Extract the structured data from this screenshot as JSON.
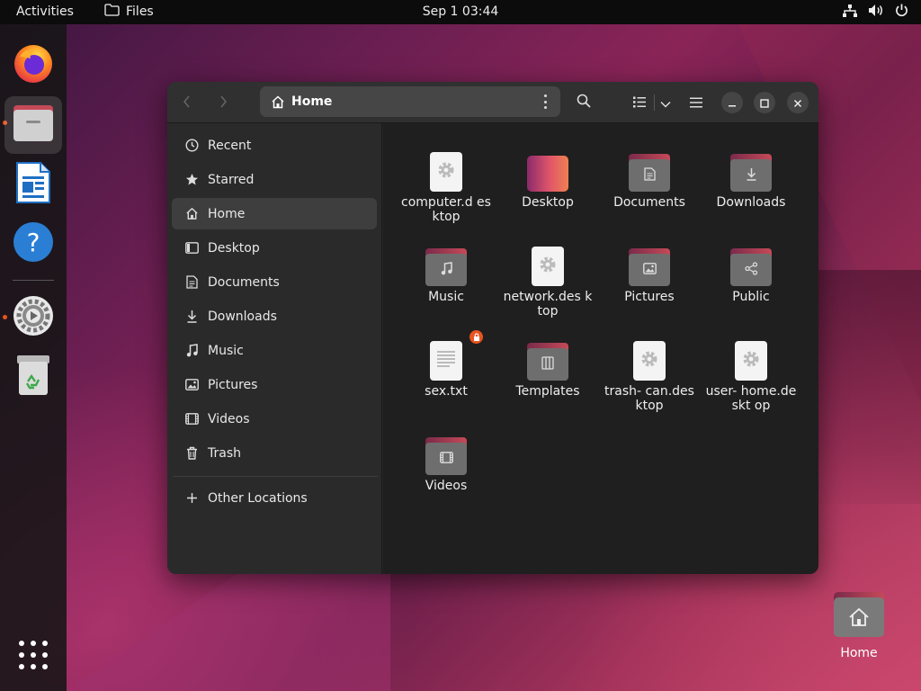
{
  "topbar": {
    "activities": "Activities",
    "app_name": "Files",
    "clock": "Sep 1  03:44"
  },
  "dock": {
    "items": [
      {
        "name": "Firefox",
        "icon": "firefox-icon",
        "running": false
      },
      {
        "name": "Files",
        "icon": "files-icon",
        "running": true,
        "active": true
      },
      {
        "name": "LibreOffice Writer",
        "icon": "writer-icon",
        "running": false
      },
      {
        "name": "Help",
        "icon": "help-icon",
        "running": false
      },
      {
        "name": "Settings",
        "icon": "settings-icon",
        "running": true
      },
      {
        "name": "Trash",
        "icon": "trash-icon",
        "running": false
      }
    ],
    "apps_grid": "show-apps-icon"
  },
  "window": {
    "path_label": "Home",
    "sidebar": {
      "items": [
        {
          "label": "Recent",
          "icon": "clock-icon"
        },
        {
          "label": "Starred",
          "icon": "star-icon"
        },
        {
          "label": "Home",
          "icon": "home-icon",
          "selected": true
        },
        {
          "label": "Desktop",
          "icon": "desktop-icon"
        },
        {
          "label": "Documents",
          "icon": "document-icon"
        },
        {
          "label": "Downloads",
          "icon": "download-icon"
        },
        {
          "label": "Music",
          "icon": "music-icon"
        },
        {
          "label": "Pictures",
          "icon": "picture-icon"
        },
        {
          "label": "Videos",
          "icon": "video-icon"
        },
        {
          "label": "Trash",
          "icon": "trash-icon"
        }
      ],
      "other_locations": "Other Locations"
    },
    "files": [
      {
        "name": "computer.d esktop",
        "kind": "desktop-file"
      },
      {
        "name": "Desktop",
        "kind": "desktop-folder"
      },
      {
        "name": "Documents",
        "kind": "folder",
        "glyph": "document-icon"
      },
      {
        "name": "Downloads",
        "kind": "folder",
        "glyph": "download-icon"
      },
      {
        "name": "Music",
        "kind": "folder",
        "glyph": "music-icon"
      },
      {
        "name": "network.des ktop",
        "kind": "desktop-file"
      },
      {
        "name": "Pictures",
        "kind": "folder",
        "glyph": "picture-icon"
      },
      {
        "name": "Public",
        "kind": "folder",
        "glyph": "share-icon"
      },
      {
        "name": "sex.txt",
        "kind": "text-file",
        "locked": true
      },
      {
        "name": "Templates",
        "kind": "folder",
        "glyph": "template-icon"
      },
      {
        "name": "trash- can.desktop",
        "kind": "desktop-file"
      },
      {
        "name": "user- home.deskt op",
        "kind": "desktop-file"
      },
      {
        "name": "Videos",
        "kind": "folder",
        "glyph": "video-icon"
      }
    ]
  },
  "desktop": {
    "home_label": "Home"
  },
  "colors": {
    "accent": "#e95420",
    "window_bg": "#242424",
    "sidebar_bg": "#2a2a2a",
    "folder_tab": "#c54a58"
  }
}
